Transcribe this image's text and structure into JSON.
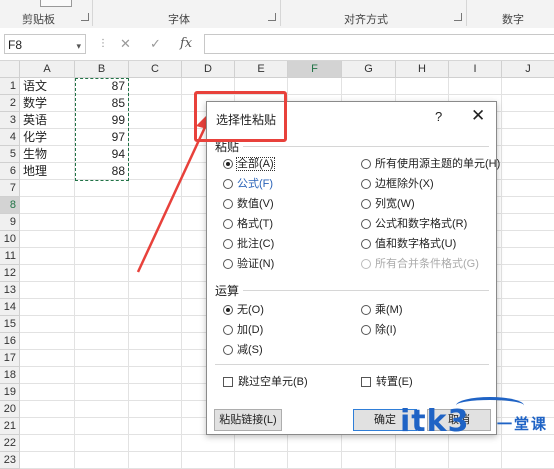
{
  "ribbon": {
    "groups": [
      "剪贴板",
      "字体",
      "对齐方式",
      "数字"
    ]
  },
  "formula_bar": {
    "name_box": "F8",
    "fx_label": "fx",
    "cancel_icon": "close-icon",
    "enter_icon": "check-icon"
  },
  "columns": [
    "A",
    "B",
    "C",
    "D",
    "E",
    "F",
    "G",
    "H",
    "I",
    "J"
  ],
  "rows": [
    "1",
    "2",
    "3",
    "4",
    "5",
    "6",
    "7",
    "8",
    "9",
    "10",
    "11",
    "12",
    "13",
    "14",
    "15",
    "16",
    "17",
    "18",
    "19",
    "20",
    "21",
    "22",
    "23"
  ],
  "cells": {
    "A": [
      "语文",
      "数学",
      "英语",
      "化学",
      "生物",
      "地理"
    ],
    "B": [
      "87",
      "85",
      "99",
      "97",
      "94",
      "88"
    ]
  },
  "selection": {
    "active_cell": "F8",
    "active_col": "F",
    "active_row": "8"
  },
  "dialog": {
    "title": "选择性粘贴",
    "help": "?",
    "close": "✕",
    "paste_section": "粘贴",
    "paste_options_left": [
      "全部(A)",
      "公式(F)",
      "数值(V)",
      "格式(T)",
      "批注(C)",
      "验证(N)"
    ],
    "paste_options_right": [
      "所有使用源主题的单元(H)",
      "边框除外(X)",
      "列宽(W)",
      "公式和数字格式(R)",
      "值和数字格式(U)",
      "所有合并条件格式(G)"
    ],
    "operation_section": "运算",
    "operation_left": [
      "无(O)",
      "加(D)",
      "减(S)"
    ],
    "operation_right": [
      "乘(M)",
      "除(I)"
    ],
    "skip_blanks": "跳过空单元(B)",
    "transpose": "转置(E)",
    "paste_link_button": "粘贴链接(L)",
    "ok_button": "确定",
    "cancel_button": "取消"
  },
  "watermark": {
    "text": "itk3",
    "suffix": "一堂课"
  },
  "colors": {
    "accent_green": "#217346",
    "annotation_red": "#e8413b",
    "watermark_blue": "#1f63c5"
  }
}
